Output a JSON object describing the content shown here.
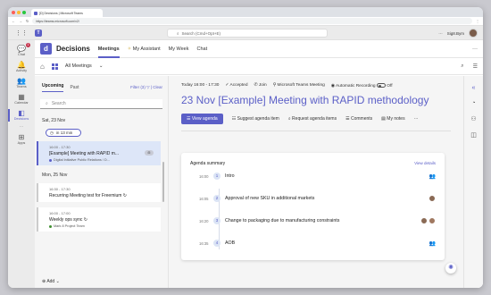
{
  "browser": {
    "tab_title": "[D] Decisions | Microsoft Teams",
    "url": "https://teams.microsoft.com/v2/"
  },
  "teams": {
    "search_placeholder": "Search (Cmd+Opt+E)",
    "more": "···",
    "user": "Sig8.Bym"
  },
  "rail": {
    "items": [
      {
        "label": "Chat",
        "badge": "1"
      },
      {
        "label": "Activity"
      },
      {
        "label": "Teams"
      },
      {
        "label": "Calendar"
      },
      {
        "label": "Decisions"
      },
      {
        "label": "···"
      },
      {
        "label": "Apps"
      }
    ]
  },
  "app": {
    "logo": "d",
    "name": "Decisions",
    "tabs": [
      "Meetings",
      "My Assistant",
      "My Week",
      "Chat"
    ],
    "more": "···",
    "filter": "All Meetings"
  },
  "list": {
    "tab_upcoming": "Upcoming",
    "tab_past": "Past",
    "filter": "Filter (3)",
    "clear": "| Clear",
    "search_placeholder": "Search",
    "day1": "Sat, 23 Nov",
    "now_chip": "in 13 min",
    "meetings": [
      {
        "time": "16:00 - 17:30",
        "title": "[Example] Meeting with RAPID m...",
        "tag": "Digital Initiative Public Relations / D...",
        "chip": "⊟"
      },
      {
        "time": "16:30 - 17:30",
        "title": "Recurring Meeting test for Freemium ↻",
        "tag": ""
      },
      {
        "time": "16:00 - 17:00",
        "title": "Weekly ops sync ↻",
        "tag": "Mark 8 Project Team"
      }
    ],
    "day2": "Mon, 25 Nov",
    "add": "Add"
  },
  "meeting": {
    "when": "Today 16:00 - 17:30",
    "accepted": "Accepted",
    "join": "Join",
    "location": "Microsoft Teams Meeting",
    "recording": "Automatic Recording",
    "recording_state": "Off",
    "title": "23 Nov [Example] Meeting with RAPID methodology",
    "actions": {
      "view_agenda": "View agenda",
      "suggest": "Suggest agenda item",
      "request": "Request agenda items",
      "comments": "Comments",
      "notes": "My notes",
      "more": "···"
    },
    "agenda": {
      "title": "Agenda summary",
      "view_details": "View details",
      "items": [
        {
          "time": "16:00",
          "num": "1",
          "label": "Intro"
        },
        {
          "time": "16:05",
          "num": "2",
          "label": "Approval of new SKU in additional markets"
        },
        {
          "time": "16:20",
          "num": "3",
          "label": "Change to packaging due to manufacturing constraints"
        },
        {
          "time": "16:35",
          "num": "4",
          "label": "AOB"
        }
      ]
    }
  },
  "colors": {
    "accent": "#5b5fc7",
    "selected": "#dde6f8"
  }
}
